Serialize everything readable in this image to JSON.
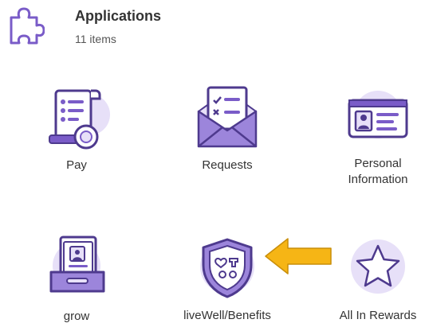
{
  "header": {
    "title": "Applications",
    "count": "11 items",
    "icon": "puzzle-icon"
  },
  "apps": [
    {
      "label": "Pay",
      "icon": "pay-icon"
    },
    {
      "label": "Requests",
      "icon": "requests-icon"
    },
    {
      "label": "Personal\nInformation",
      "icon": "personal-info-icon"
    },
    {
      "label": "grow",
      "icon": "grow-icon"
    },
    {
      "label": "liveWell/Benefits",
      "icon": "benefits-shield-icon"
    },
    {
      "label": "All In Rewards",
      "icon": "rewards-star-icon"
    }
  ],
  "annotation": {
    "icon": "arrow-icon",
    "color": "#F6B515"
  },
  "colors": {
    "accent": "#7A5CC8",
    "accent_light": "#E7E0F8",
    "accent_dark": "#4E3A8E"
  }
}
